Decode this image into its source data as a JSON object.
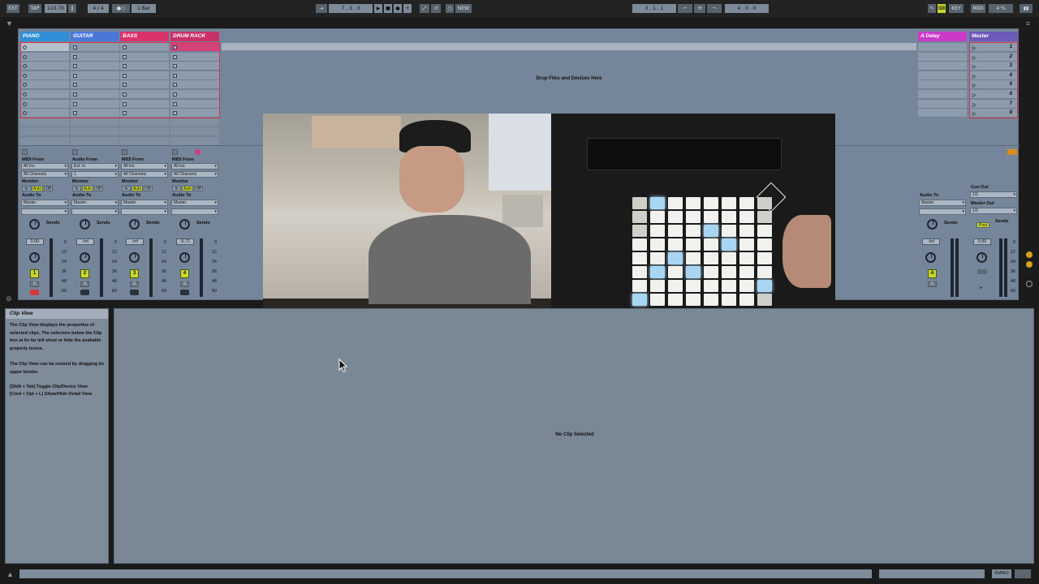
{
  "transport": {
    "ext": "EXT",
    "tap": "TAP",
    "tempo": "110.70",
    "signature": "4 / 4",
    "quantize": "1 Bar",
    "position": [
      "7",
      "3",
      "3"
    ],
    "new": "NEW",
    "loop_start": [
      "3",
      "1",
      "1"
    ],
    "loop_length": [
      "4",
      "0",
      "0"
    ],
    "key": "KEY",
    "midi": "MIDI",
    "cpu": "4 %"
  },
  "tracks": [
    {
      "name": "PIANO",
      "color": "#2f8fd6",
      "io_label": "MIDI From",
      "io_source": "All Ins",
      "io_channel": "All Channels",
      "monitor": "Monitor",
      "audio_to": "Audio To",
      "audio_to_value": "Master",
      "sends": "Sends",
      "volume": "0.00",
      "number": "1"
    },
    {
      "name": "GUITAR",
      "color": "#4b78d8",
      "io_label": "Audio From",
      "io_source": "Ext. In",
      "io_channel": "1",
      "monitor": "Monitor",
      "audio_to": "Audio To",
      "audio_to_value": "Master",
      "sends": "Sends",
      "volume": "-Inf",
      "number": "2"
    },
    {
      "name": "BASS",
      "color": "#d9336a",
      "io_label": "MIDI From",
      "io_source": "All Ins",
      "io_channel": "All Channels",
      "monitor": "Monitor",
      "audio_to": "Audio To",
      "audio_to_value": "Master",
      "sends": "Sends",
      "volume": "-Inf",
      "number": "3"
    },
    {
      "name": "DRUM RACK",
      "color": "#c7326b",
      "io_label": "MIDI From",
      "io_source": "All Ins",
      "io_channel": "All Channels",
      "monitor": "Monitor",
      "audio_to": "Audio To",
      "audio_to_value": "Master",
      "sends": "Sends",
      "volume": "-5.71",
      "number": "4"
    }
  ],
  "monitor_options": [
    "In",
    "Auto",
    "Off"
  ],
  "meter_scale": [
    "0",
    "12",
    "24",
    "36",
    "48",
    "60"
  ],
  "drop_hint": "Drop Files and Devices Here",
  "return_track": {
    "name": "A Delay",
    "color": "#c93ac9",
    "audio_to": "Audio To",
    "audio_to_value": "Master",
    "sends": "Sends",
    "volume": "-Inf",
    "label": "A"
  },
  "master_track": {
    "name": "Master",
    "color": "#6c59b9",
    "scenes": [
      "1",
      "2",
      "3",
      "4",
      "5",
      "6",
      "7",
      "8"
    ],
    "cue_out": "Cue Out",
    "cue_value": "1/2",
    "master_out": "Master Out",
    "master_value": "1/2",
    "post": "Post",
    "sends": "Sends",
    "volume": "0.00"
  },
  "help": {
    "title": "Clip View",
    "body": "The Clip View displays the properties of selected clips. The selectors below the Clip box at its far left show or hide the available property boxes.",
    "resize": "The Clip View can be resized by dragging its upper border.",
    "shortcut1": "[Shift + Tab] Toggle Clip/Device View",
    "shortcut2": "[Cmd + Opt + L] Show/Hide Detail View"
  },
  "clip_view": {
    "empty_text": "No Clip Selected"
  },
  "status_bar": {
    "track": "PIANO"
  },
  "colors": {
    "accent": "#c9d72b",
    "panel": "#75869a",
    "background": "#1b1b1b",
    "record": "#d23a3a"
  }
}
